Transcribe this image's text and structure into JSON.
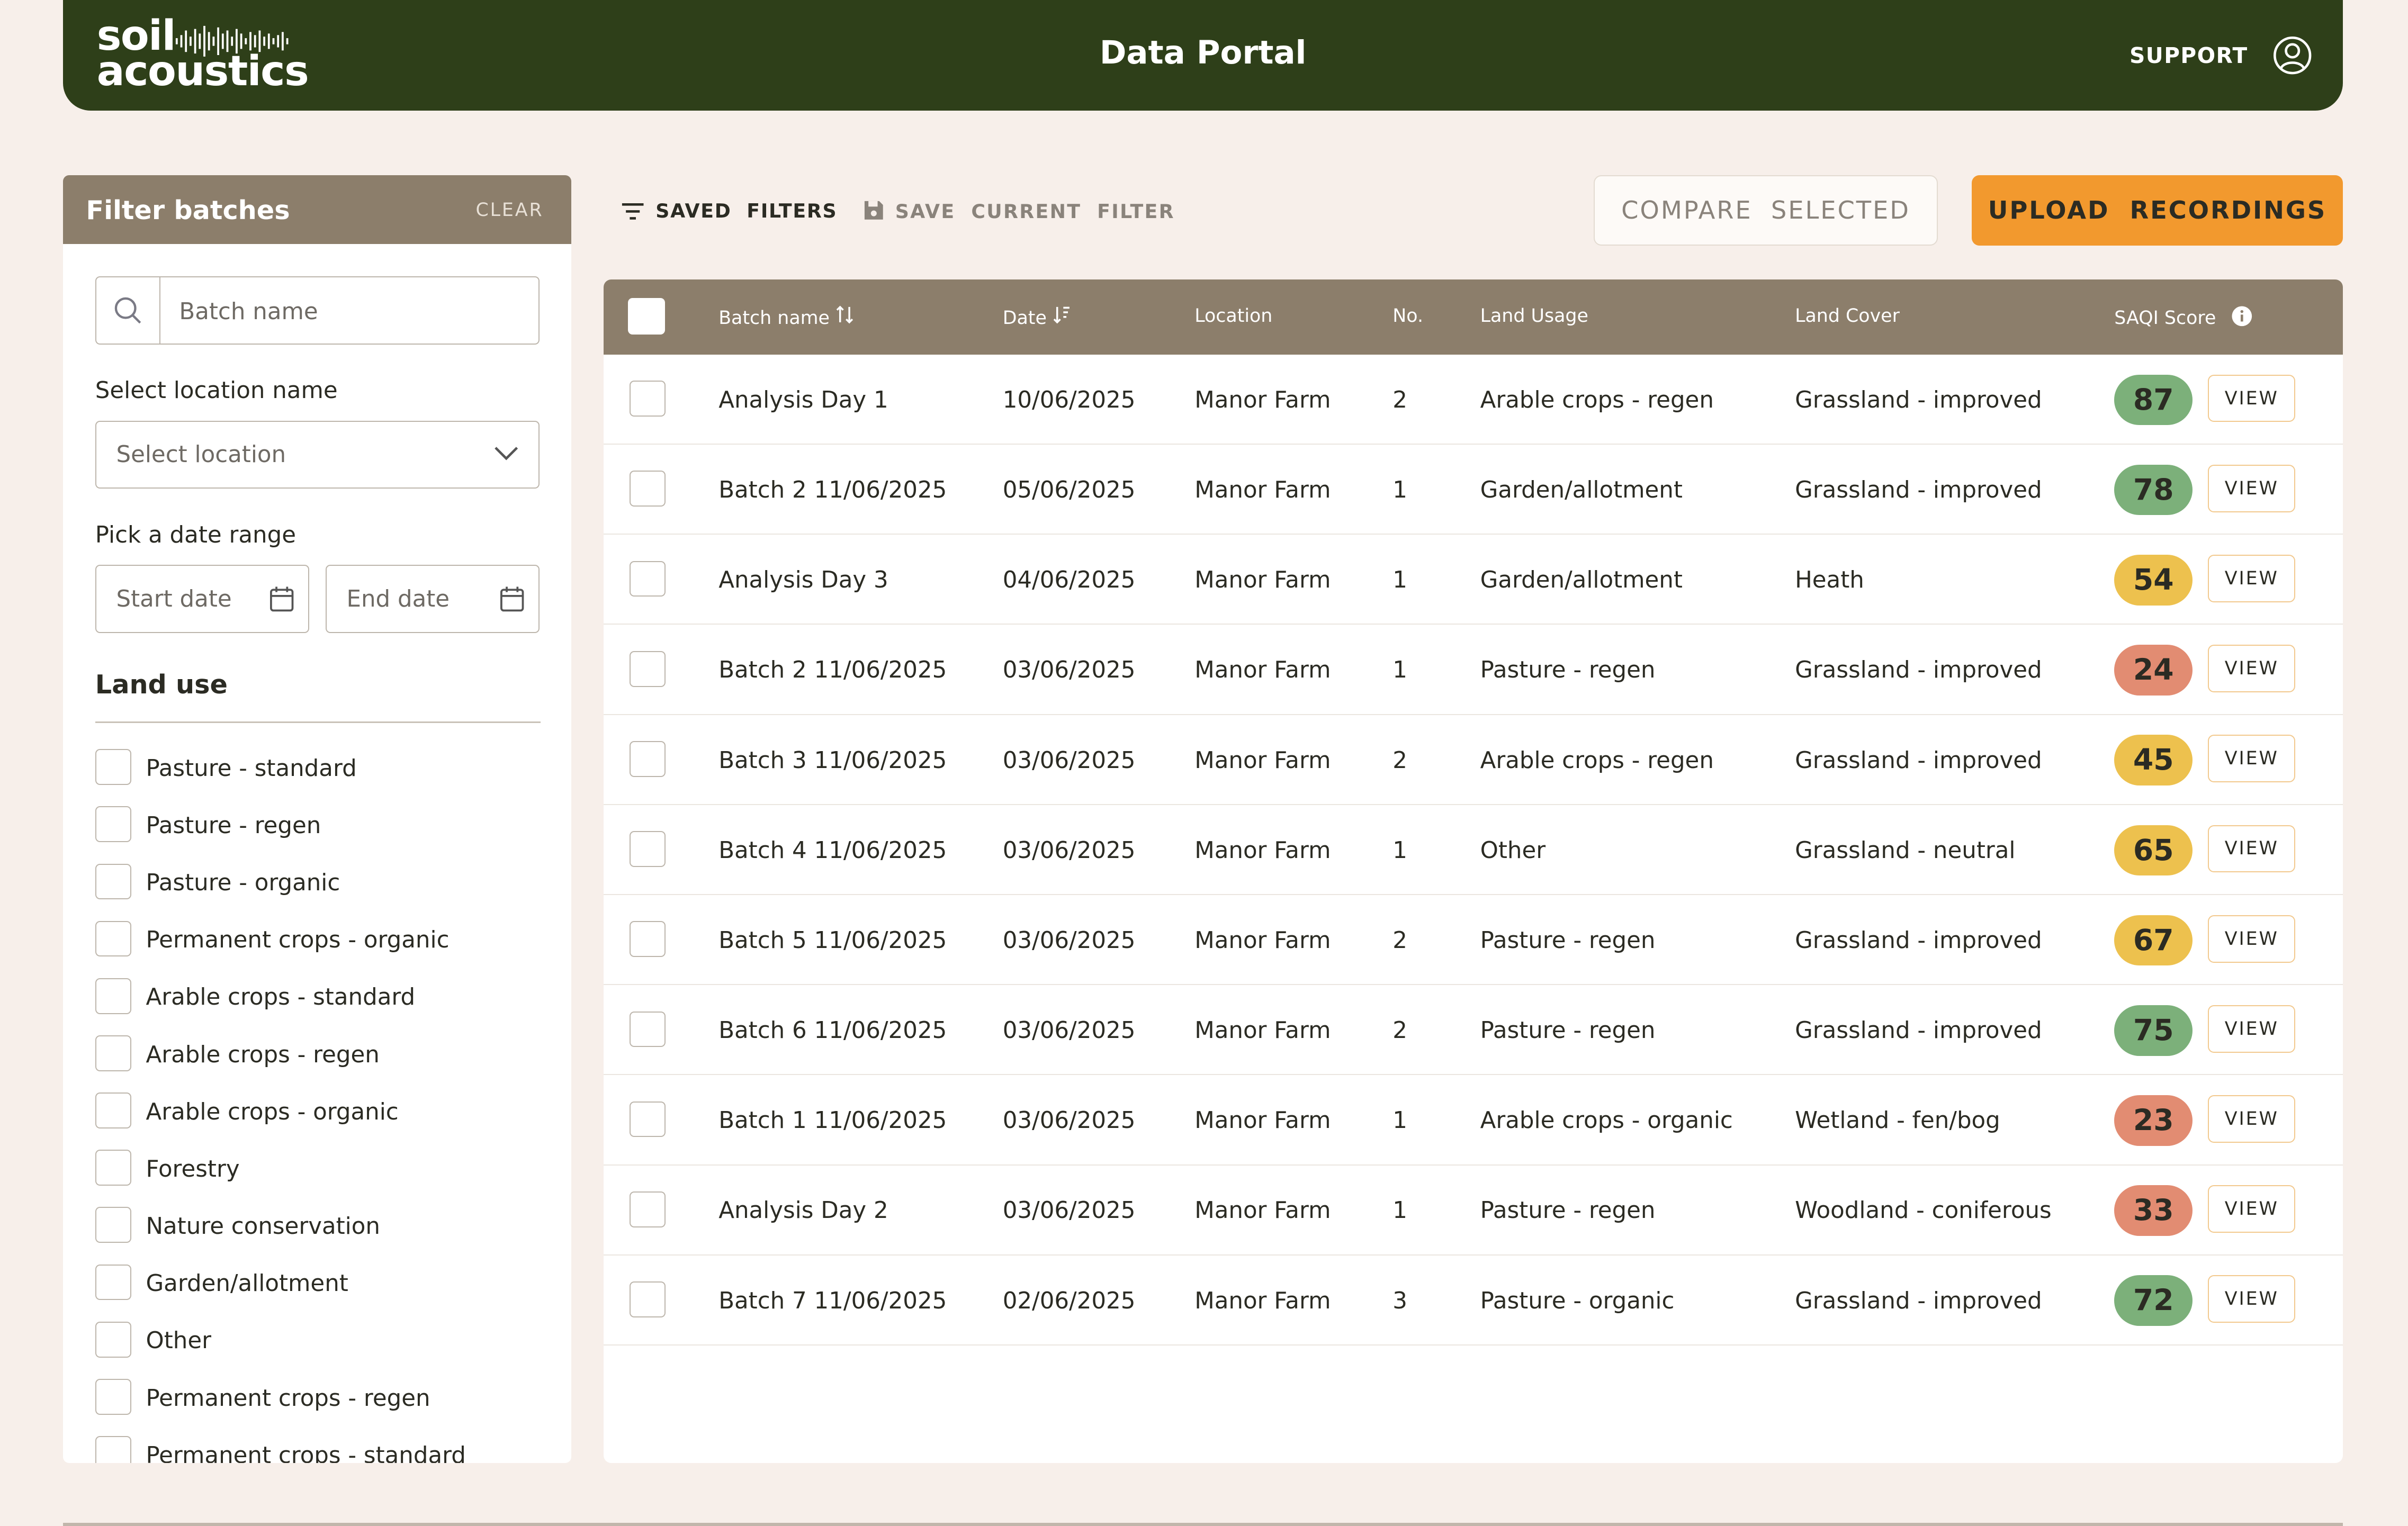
{
  "header": {
    "logo_line1": "soil",
    "logo_line2": "acoustics",
    "title": "Data Portal",
    "support_label": "SUPPORT",
    "user_icon": "user-circle-icon"
  },
  "sidebar": {
    "title": "Filter batches",
    "clear_label": "CLEAR",
    "search_placeholder": "Batch name",
    "location_label": "Select location name",
    "location_placeholder": "Select location",
    "date_label": "Pick a date range",
    "start_date_placeholder": "Start date",
    "end_date_placeholder": "End date",
    "land_use_heading": "Land use",
    "land_use_options": [
      "Pasture - standard",
      "Pasture - regen",
      "Pasture - organic",
      "Permanent crops - organic",
      "Arable crops - standard",
      "Arable crops - regen",
      "Arable crops - organic",
      "Forestry",
      "Nature conservation",
      "Garden/allotment",
      "Other",
      "Permanent crops - regen",
      "Permanent crops - standard"
    ]
  },
  "toolbar": {
    "saved_filters": "SAVED  FILTERS",
    "save_current_filter": "SAVE  CURRENT  FILTER",
    "compare_selected": "COMPARE  SELECTED",
    "upload_recordings": "UPLOAD  RECORDINGS"
  },
  "table": {
    "headers": {
      "batch_name": "Batch name",
      "date": "Date",
      "location": "Location",
      "number": "No.",
      "land_usage": "Land Usage",
      "land_cover": "Land Cover",
      "saqi_score": "SAQI Score"
    },
    "view_label": "VIEW",
    "score_colors": {
      "high": "#7cb07a",
      "medium": "#edc14e",
      "low": "#e28c72"
    },
    "rows": [
      {
        "batch_name": "Analysis Day 1",
        "date": "10/06/2025",
        "location": "Manor Farm",
        "number": "2",
        "land_usage": "Arable crops - regen",
        "land_cover": "Grassland - improved",
        "score": "87",
        "band": "high"
      },
      {
        "batch_name": "Batch 2 11/06/2025",
        "date": "05/06/2025",
        "location": "Manor Farm",
        "number": "1",
        "land_usage": "Garden/allotment",
        "land_cover": "Grassland - improved",
        "score": "78",
        "band": "high"
      },
      {
        "batch_name": "Analysis Day 3",
        "date": "04/06/2025",
        "location": "Manor Farm",
        "number": "1",
        "land_usage": "Garden/allotment",
        "land_cover": "Heath",
        "score": "54",
        "band": "medium"
      },
      {
        "batch_name": "Batch 2 11/06/2025",
        "date": "03/06/2025",
        "location": "Manor Farm",
        "number": "1",
        "land_usage": "Pasture - regen",
        "land_cover": "Grassland - improved",
        "score": "24",
        "band": "low"
      },
      {
        "batch_name": "Batch 3 11/06/2025",
        "date": "03/06/2025",
        "location": "Manor Farm",
        "number": "2",
        "land_usage": "Arable crops - regen",
        "land_cover": "Grassland - improved",
        "score": "45",
        "band": "medium"
      },
      {
        "batch_name": "Batch 4 11/06/2025",
        "date": "03/06/2025",
        "location": "Manor Farm",
        "number": "1",
        "land_usage": "Other",
        "land_cover": "Grassland - neutral",
        "score": "65",
        "band": "medium"
      },
      {
        "batch_name": "Batch 5 11/06/2025",
        "date": "03/06/2025",
        "location": "Manor Farm",
        "number": "2",
        "land_usage": "Pasture - regen",
        "land_cover": "Grassland - improved",
        "score": "67",
        "band": "medium"
      },
      {
        "batch_name": "Batch 6 11/06/2025",
        "date": "03/06/2025",
        "location": "Manor Farm",
        "number": "2",
        "land_usage": "Pasture - regen",
        "land_cover": "Grassland - improved",
        "score": "75",
        "band": "high"
      },
      {
        "batch_name": "Batch 1 11/06/2025",
        "date": "03/06/2025",
        "location": "Manor Farm",
        "number": "1",
        "land_usage": "Arable crops - organic",
        "land_cover": "Wetland - fen/bog",
        "score": "23",
        "band": "low"
      },
      {
        "batch_name": "Analysis Day 2",
        "date": "03/06/2025",
        "location": "Manor Farm",
        "number": "1",
        "land_usage": "Pasture - regen",
        "land_cover": "Woodland - coniferous",
        "score": "33",
        "band": "low"
      },
      {
        "batch_name": "Batch 7 11/06/2025",
        "date": "02/06/2025",
        "location": "Manor Farm",
        "number": "3",
        "land_usage": "Pasture - organic",
        "land_cover": "Grassland - improved",
        "score": "72",
        "band": "high"
      }
    ]
  }
}
